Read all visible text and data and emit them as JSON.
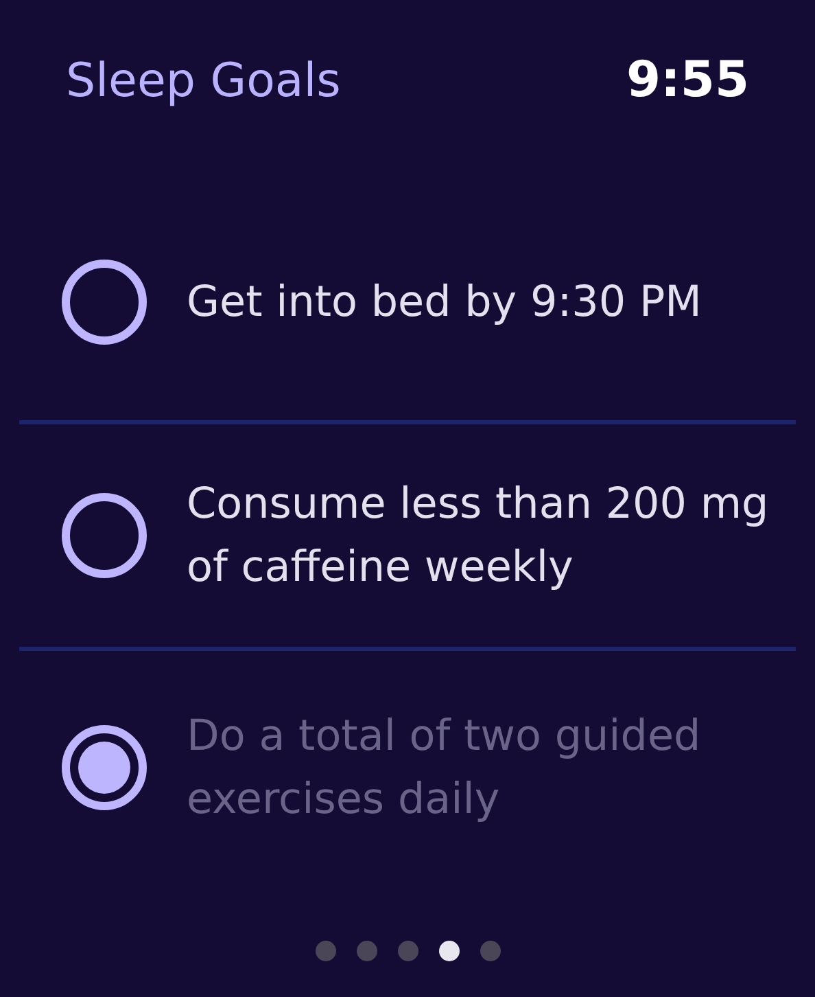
{
  "header": {
    "title": "Sleep Goals",
    "time": "9:55"
  },
  "goals": [
    {
      "label": "Get into bed by 9:30 PM",
      "checked": false
    },
    {
      "label": "Consume less than 200 mg of caffeine weekly",
      "checked": false
    },
    {
      "label": "Do a total of two guided exercises daily",
      "checked": true
    }
  ],
  "page_dots": [
    {
      "selected": false
    },
    {
      "selected": false
    },
    {
      "selected": false
    },
    {
      "selected": true
    },
    {
      "selected": false
    }
  ]
}
